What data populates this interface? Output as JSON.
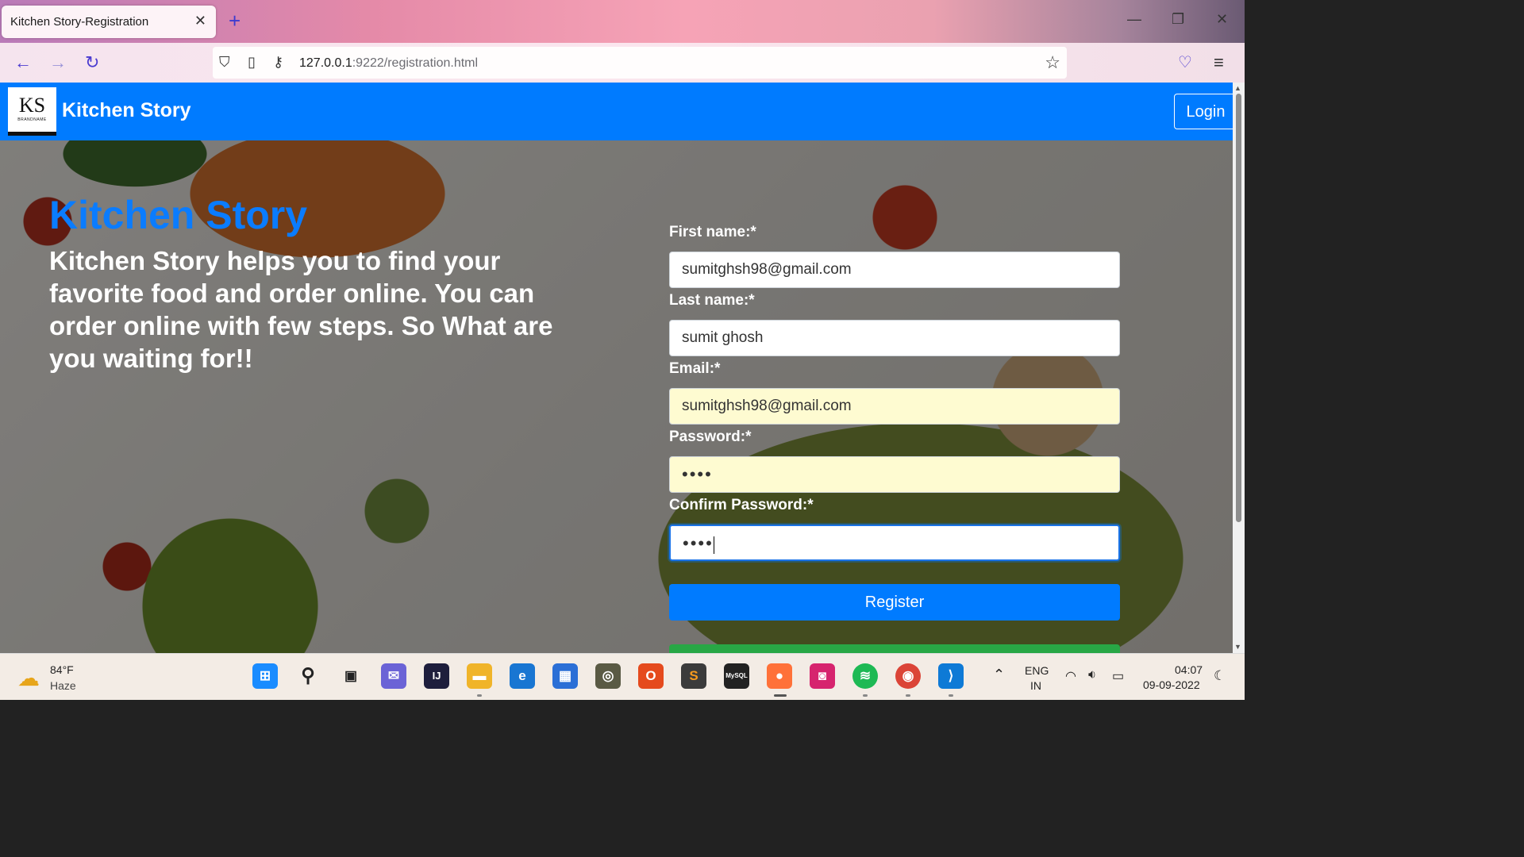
{
  "browser": {
    "tab_title": "Kitchen Story-Registration",
    "url_host": "127.0.0.1",
    "url_rest": ":9222/registration.html"
  },
  "site": {
    "logo_text": "KS",
    "logo_sub": "BRANDNAME",
    "brand": "Kitchen Story",
    "login_label": "Login"
  },
  "hero": {
    "title": "Kitchen Story",
    "description": "Kitchen Story helps you to find your favorite food and order online. You can order online with few steps. So What are you waiting for!!"
  },
  "form": {
    "first_name_label": "First name:*",
    "first_name_value": "sumitghsh98@gmail.com",
    "last_name_label": "Last name:*",
    "last_name_value": "sumit ghosh",
    "email_label": "Email:*",
    "email_value": "sumitghsh98@gmail.com",
    "password_label": "Password:*",
    "password_value": "••••",
    "confirm_label": "Confirm Password:*",
    "confirm_value": "••••",
    "register_label": "Register"
  },
  "taskbar": {
    "temp": "84°F",
    "condition": "Haze",
    "lang_top": "ENG",
    "lang_bottom": "IN",
    "time": "04:07",
    "date": "09-09-2022"
  },
  "colors": {
    "header": "#007bff",
    "hero_title": "#0a7cff",
    "register": "#007bff",
    "autofill": "#fefbd1"
  }
}
